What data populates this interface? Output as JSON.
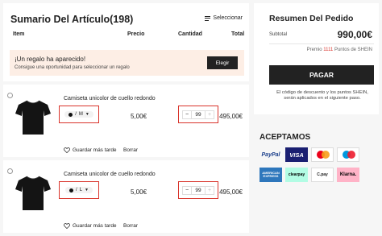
{
  "summary": {
    "title": "Sumario Del Artículo(198)",
    "select_label": "Seleccionar",
    "columns": {
      "item": "Item",
      "price": "Precio",
      "quantity": "Cantidad",
      "total": "Total"
    },
    "gift": {
      "title": "¡Un regalo ha aparecido!",
      "subtitle": "Consigue una oportunidad para seleccionar un regalo",
      "button": "Elegir"
    }
  },
  "products": [
    {
      "name": "Camiseta unicolor de cuello redondo",
      "size": "M",
      "color": "#111111",
      "price": "5,00€",
      "minus": "−",
      "quantity": "99",
      "plus": "+",
      "total": "495,00€",
      "wishlist": "Guardar más tarde",
      "delete": "Borrar"
    },
    {
      "name": "Camiseta unicolor de cuello redondo",
      "size": "L",
      "color": "#111111",
      "price": "5,00€",
      "minus": "−",
      "quantity": "99",
      "plus": "+",
      "total": "495,00€",
      "wishlist": "Guardar más tarde",
      "delete": "Borrar"
    }
  ],
  "order": {
    "title": "Resumen Del Pedido",
    "subtotal_label": "Subtotal",
    "subtotal_value": "990,00€",
    "points_prefix": "Premio",
    "points_value": "1111",
    "points_suffix": "Puntos de SHEIN",
    "pay_button": "PAGAR",
    "note": "El código de descuento y los puntos SHEIN, serán aplicados en el siguiente paso."
  },
  "payments": {
    "title": "ACEPTAMOS",
    "methods": {
      "paypal": "PayPal",
      "visa": "VISA",
      "amex": "AMERICAN EXPRESS",
      "clearpay": "clearpay",
      "cpay": "C.pay",
      "klarna": "Klarna."
    }
  },
  "colors": {
    "accent_red": "#d9342b",
    "dark_button": "#222222",
    "gift_banner": "#fdeee5"
  }
}
